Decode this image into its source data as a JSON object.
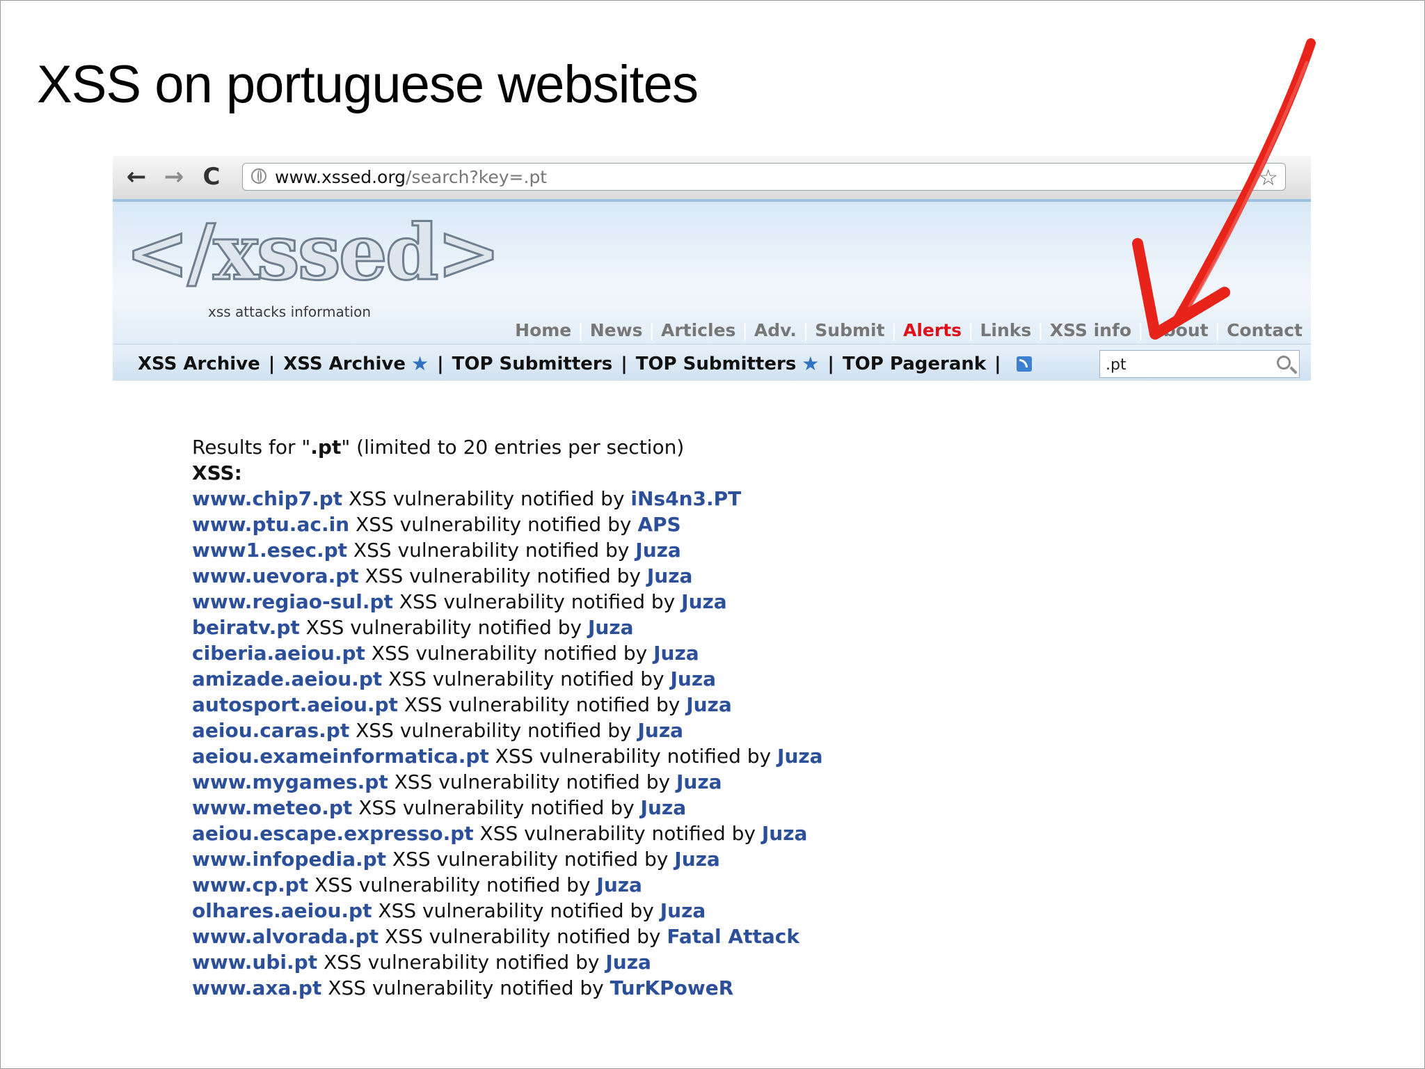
{
  "slide": {
    "title": "XSS on portuguese websites"
  },
  "browser": {
    "url_host": "www.xssed.org",
    "url_path": "/search?key=.pt",
    "back": "←",
    "forward": "→",
    "reload": "C",
    "bookmark": "☆"
  },
  "site": {
    "logo": "</xssed>",
    "tagline": "xss attacks information",
    "nav": [
      "Home",
      "News",
      "Articles",
      "Adv.",
      "Submit",
      "Alerts",
      "Links",
      "XSS info",
      "About",
      "Contact"
    ],
    "subnav": [
      "XSS Archive",
      "XSS Archive",
      "TOP Submitters",
      "TOP Submitters",
      "TOP Pagerank"
    ],
    "search_value": ".pt"
  },
  "results": {
    "prefix": "Results for \"",
    "query": ".pt",
    "suffix": "\" (limited to 20 entries per section)",
    "section": "XSS:",
    "middle": " XSS vulnerability notified by ",
    "items": [
      {
        "site": "www.chip7.pt",
        "by": "iNs4n3.PT"
      },
      {
        "site": "www.ptu.ac.in",
        "by": "APS"
      },
      {
        "site": "www1.esec.pt",
        "by": "Juza"
      },
      {
        "site": "www.uevora.pt",
        "by": "Juza"
      },
      {
        "site": "www.regiao-sul.pt",
        "by": "Juza"
      },
      {
        "site": "beiratv.pt",
        "by": "Juza"
      },
      {
        "site": "ciberia.aeiou.pt",
        "by": "Juza"
      },
      {
        "site": "amizade.aeiou.pt",
        "by": "Juza"
      },
      {
        "site": "autosport.aeiou.pt",
        "by": "Juza"
      },
      {
        "site": "aeiou.caras.pt",
        "by": "Juza"
      },
      {
        "site": "aeiou.exameinformatica.pt",
        "by": "Juza"
      },
      {
        "site": "www.mygames.pt",
        "by": "Juza"
      },
      {
        "site": "www.meteo.pt",
        "by": "Juza"
      },
      {
        "site": "aeiou.escape.expresso.pt",
        "by": "Juza"
      },
      {
        "site": "www.infopedia.pt",
        "by": "Juza"
      },
      {
        "site": "www.cp.pt",
        "by": "Juza"
      },
      {
        "site": "olhares.aeiou.pt",
        "by": "Juza"
      },
      {
        "site": "www.alvorada.pt",
        "by": "Fatal Attack"
      },
      {
        "site": "www.ubi.pt",
        "by": "Juza"
      },
      {
        "site": "www.axa.pt",
        "by": "TurKPoweR"
      }
    ]
  },
  "colors": {
    "link": "#2c4f9a",
    "alert": "#e0101a",
    "arrow": "#e8231a"
  }
}
